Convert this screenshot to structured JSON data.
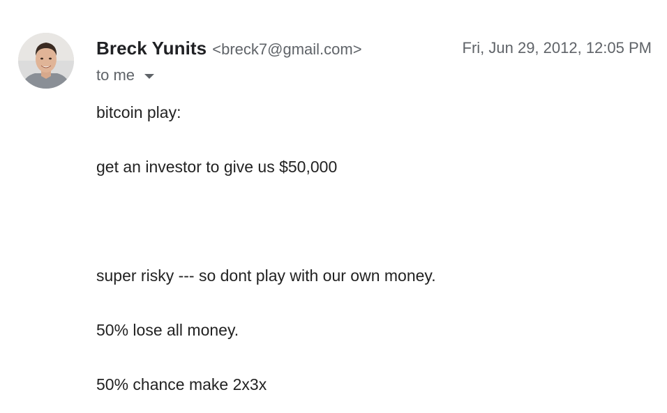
{
  "email": {
    "sender_name": "Breck Yunits",
    "sender_email": "<breck7@gmail.com>",
    "date": "Fri, Jun 29, 2012, 12:05 PM",
    "recipient_label": "to me",
    "avatar_icon": "person-photo-avatar",
    "dropdown_icon": "caret-down-icon"
  },
  "body": {
    "lines": [
      "bitcoin play:",
      "get an investor to give us $50,000",
      "super risky --- so dont play with our own money.",
      "50% lose all money.",
      "50% chance make 2x3x"
    ]
  }
}
